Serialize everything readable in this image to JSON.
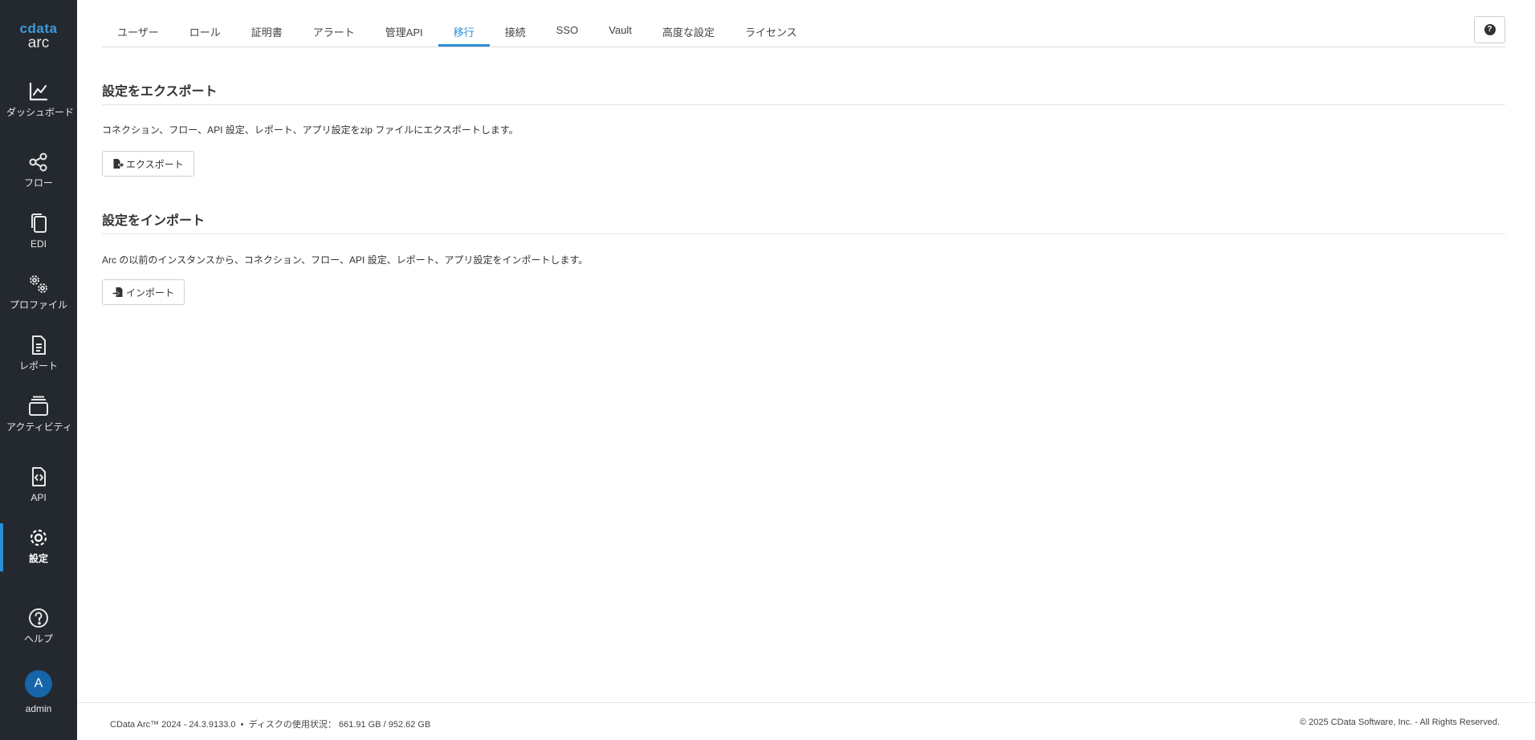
{
  "app": {
    "brand": "cdata",
    "product": "arc"
  },
  "sidebar": {
    "items": [
      {
        "label": "ダッシュボード",
        "icon": "dashboard-chart-icon"
      },
      {
        "label": "フロー",
        "icon": "flow-icon"
      },
      {
        "label": "EDI",
        "icon": "edi-copy-icon"
      },
      {
        "label": "プロファイル",
        "icon": "profile-gears-icon"
      },
      {
        "label": "レポート",
        "icon": "report-document-icon"
      },
      {
        "label": "アクティビティ",
        "icon": "activity-stack-icon"
      },
      {
        "label": "API",
        "icon": "api-file-code-icon"
      },
      {
        "label": "設定",
        "icon": "settings-gear-icon",
        "active": true
      },
      {
        "label": "ヘルプ",
        "icon": "help-circle-icon"
      }
    ],
    "user": {
      "initial": "A",
      "name": "admin"
    }
  },
  "tabs": [
    {
      "label": "ユーザー"
    },
    {
      "label": "ロール"
    },
    {
      "label": "証明書"
    },
    {
      "label": "アラート"
    },
    {
      "label": "管理API"
    },
    {
      "label": "移行",
      "active": true
    },
    {
      "label": "接続"
    },
    {
      "label": "SSO"
    },
    {
      "label": "Vault"
    },
    {
      "label": "高度な設定"
    },
    {
      "label": "ライセンス"
    }
  ],
  "help_button": {
    "glyph": "?"
  },
  "export": {
    "title": "設定をエクスポート",
    "description": "コネクション、フロー、API 設定、レポート、アプリ設定をzip ファイルにエクスポートします。",
    "button_label": "エクスポート"
  },
  "import": {
    "title": "設定をインポート",
    "description": "Arc の以前のインスタンスから、コネクション、フロー、API 設定、レポート、アプリ設定をインポートします。",
    "button_label": "インポート"
  },
  "footer": {
    "version": "CData Arc™ 2024 - 24.3.9133.0",
    "separator": "•",
    "disk_label": "ディスクの使用状況：",
    "disk_usage": "661.91 GB / 952.62 GB",
    "copyright": "© 2025 CData Software, Inc. - All Rights Reserved."
  },
  "colors": {
    "sidebar_bg": "#23292f",
    "accent": "#2b8fd8",
    "avatar": "#1565a8"
  }
}
